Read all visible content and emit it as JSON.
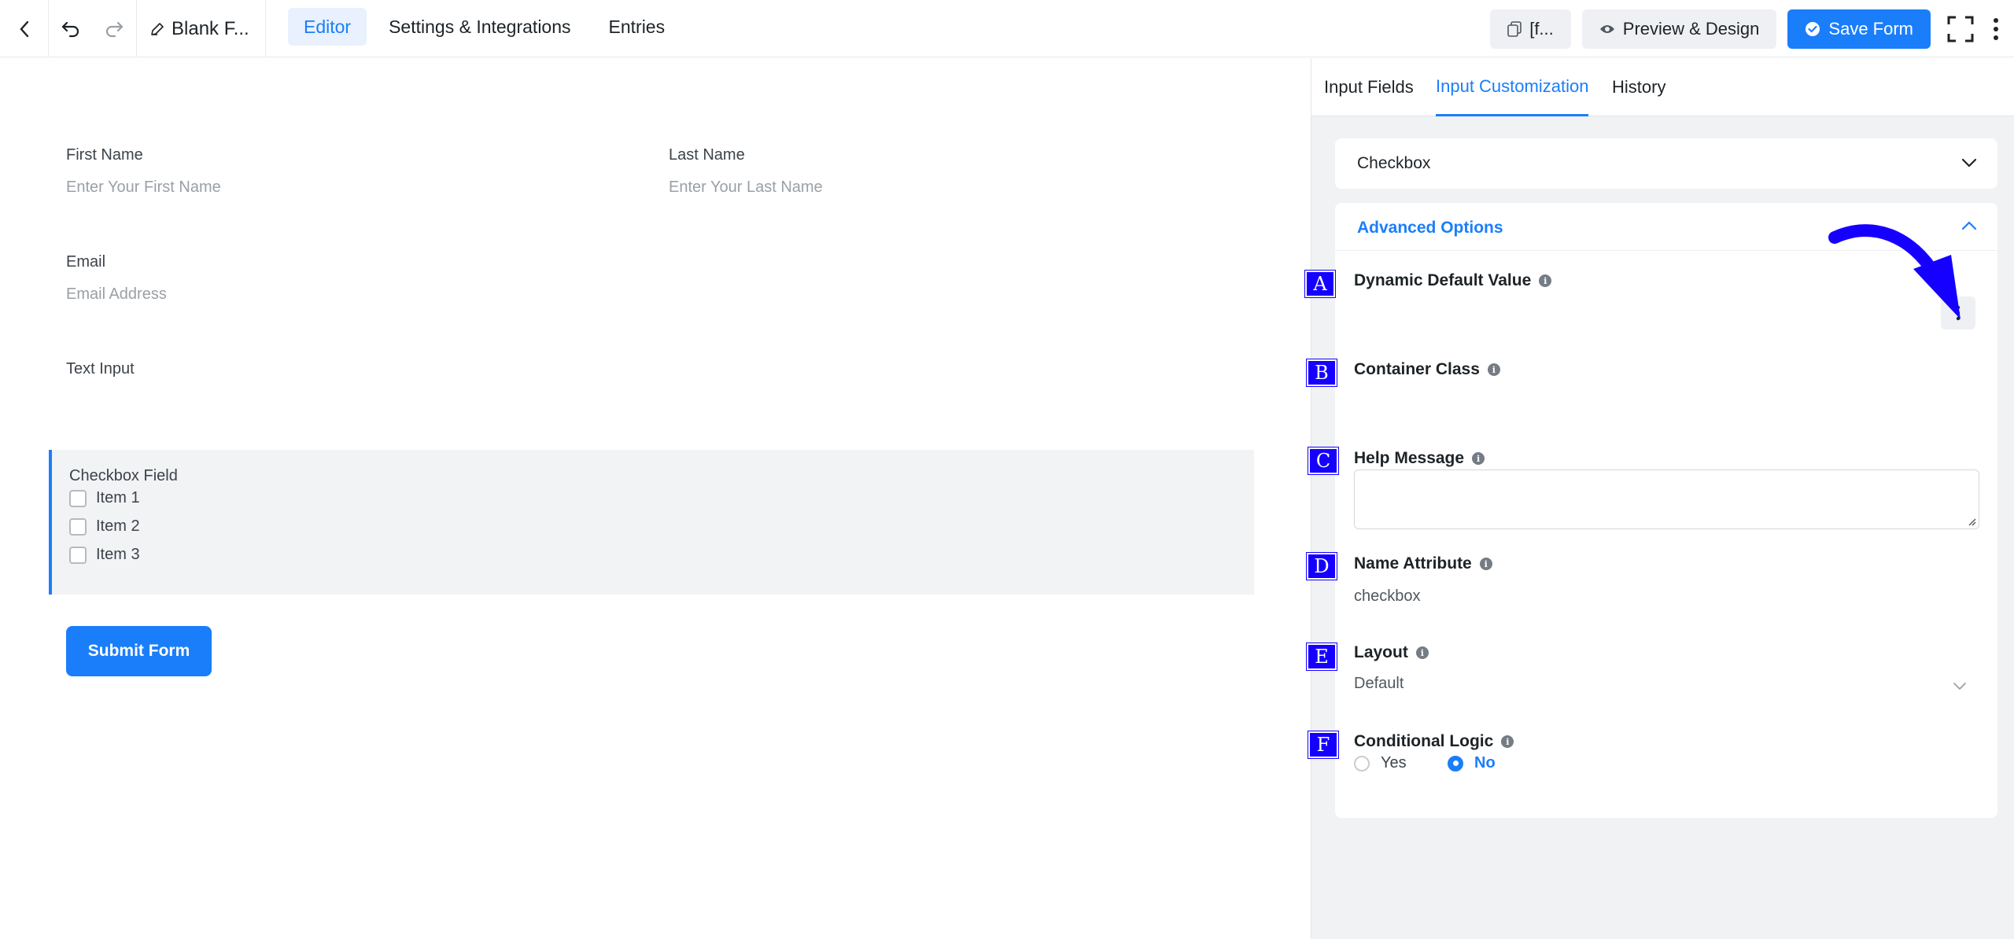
{
  "topbar": {
    "form_title": "Blank F...",
    "nav": [
      "Editor",
      "Settings & Integrations",
      "Entries"
    ],
    "shortcode_label": "[f...",
    "preview_label": "Preview & Design",
    "save_label": "Save Form"
  },
  "form": {
    "first_name_label": "First Name",
    "first_name_placeholder": "Enter Your First Name",
    "last_name_label": "Last Name",
    "last_name_placeholder": "Enter Your Last Name",
    "email_label": "Email",
    "email_placeholder": "Email Address",
    "text_input_label": "Text Input",
    "checkbox_title": "Checkbox Field",
    "checkbox_items": [
      "Item 1",
      "Item 2",
      "Item 3"
    ],
    "submit_label": "Submit Form"
  },
  "panel": {
    "tabs": [
      "Input Fields",
      "Input Customization",
      "History"
    ],
    "active_tab": "Input Customization",
    "element_select": "Checkbox",
    "advanced_title": "Advanced Options",
    "options": {
      "dynamic_default_value": "Dynamic Default Value",
      "container_class": "Container Class",
      "help_message": "Help Message",
      "name_attribute": "Name Attribute",
      "name_attribute_value": "checkbox",
      "layout": "Layout",
      "layout_value": "Default",
      "conditional_logic": "Conditional Logic",
      "radio_yes": "Yes",
      "radio_no": "No",
      "conditional_logic_selected": "No"
    },
    "badges": [
      "A",
      "B",
      "C",
      "D",
      "E",
      "F"
    ]
  },
  "colors": {
    "accent": "#1a7efb",
    "badge": "#1500ff",
    "panel_bg": "#f1f2f4"
  }
}
